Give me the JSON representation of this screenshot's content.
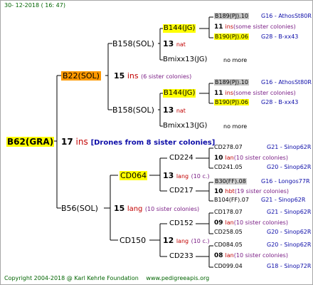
{
  "header": {
    "date": "30- 12-2018 ( 16: 47)"
  },
  "footer": {
    "copyright": "Copyright 2004-2018 @ Karl Kehrle Foundation",
    "website": "www.pedigreeapis.org"
  },
  "root": {
    "name": "B62(GRA)",
    "num": "17",
    "unit": "ins",
    "note": "[Drones from 8 sister colonies]"
  },
  "nodes": {
    "b22": {
      "name": "B22(SOL)",
      "num": "15",
      "unit": "ins",
      "note": "(6 sister colonies)"
    },
    "b56": {
      "name": "B56(SOL)",
      "num": "15",
      "unit": "lang",
      "note": "(10 sister colonies)"
    },
    "b158a": {
      "name": "B158(SOL)",
      "num": "13",
      "unit": "nat"
    },
    "b158b": {
      "name": "B158(SOL)",
      "num": "13",
      "unit": "nat"
    },
    "b144a": "B144(JG)",
    "b144b": "B144(JG)",
    "bmixx_a": "Bmixx13(JG)",
    "bmixx_b": "Bmixx13(JG)",
    "nomore": "no more",
    "cd064": {
      "name": "CD064",
      "num": "13",
      "unit": "lang",
      "note": "(10 c.)"
    },
    "cd150": {
      "name": "CD150",
      "num": "12",
      "unit": "lang",
      "note": "(10 c.)"
    },
    "cd224": "CD224",
    "cd217": "CD217",
    "cd152": "CD152",
    "cd233": "CD233"
  },
  "right": [
    {
      "name": "B189(PJ).10",
      "extra": "G16 - AthosSt80R",
      "hl": "hl-g"
    },
    {
      "num": "11",
      "unit": "ins",
      "note": "(some sister colonies)"
    },
    {
      "name": "B190(PJ).06",
      "extra": "G28 - B-xx43",
      "hl": "hl-y"
    },
    {
      "name": "B189(PJ).10",
      "extra": "G16 - AthosSt80R",
      "hl": "hl-g"
    },
    {
      "num": "11",
      "unit": "ins",
      "note": "(some sister colonies)"
    },
    {
      "name": "B190(PJ).06",
      "extra": "G28 - B-xx43",
      "hl": "hl-y"
    },
    {
      "name": "CD278.07",
      "extra": "G21 - Sinop62R"
    },
    {
      "num": "10",
      "unit": "lan",
      "note": "(10 sister colonies)"
    },
    {
      "name": "CD241.05",
      "extra": "G20 - Sinop62R"
    },
    {
      "name": "B30(FF).08",
      "extra": "G16 - Longos77R",
      "hl": "hl-b"
    },
    {
      "num": "10",
      "unit": "hbt",
      "note": "(19 sister colonies)"
    },
    {
      "name": "B104(FF).07",
      "extra": "G21 - Sinop62R"
    },
    {
      "name": "CD178.07",
      "extra": "G21 - Sinop62R"
    },
    {
      "num": "09",
      "unit": "lan",
      "note": "(10 sister colonies)"
    },
    {
      "name": "CD258.05",
      "extra": "G20 - Sinop62R"
    },
    {
      "name": "CD084.05",
      "extra": "G20 - Sinop62R"
    },
    {
      "num": "08",
      "unit": "lan",
      "note": "(10 sister colonies)"
    },
    {
      "name": "CD099.04",
      "extra": "G18 - Sinop72R"
    }
  ]
}
